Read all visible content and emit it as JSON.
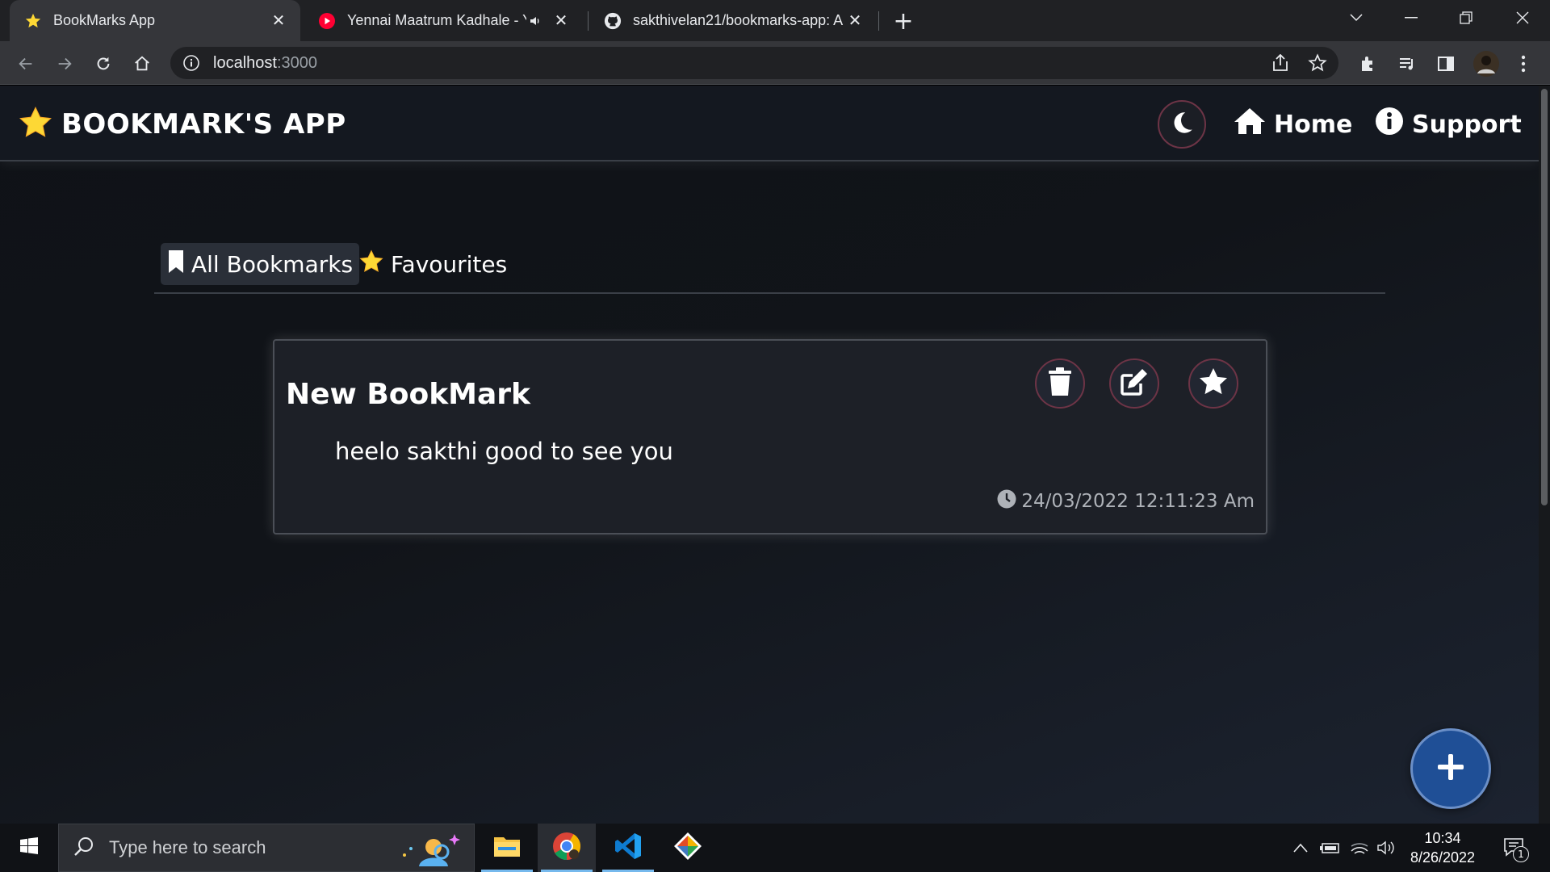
{
  "browser": {
    "tabs": [
      {
        "title": "BookMarks App",
        "favicon": "star-icon",
        "active": true
      },
      {
        "title": "Yennai Maatrum Kadhale - Yo",
        "favicon": "youtube-icon",
        "audio": true
      },
      {
        "title": "sakthivelan21/bookmarks-app: A",
        "favicon": "github-icon"
      }
    ],
    "url_host": "localhost",
    "url_port": ":3000"
  },
  "app": {
    "brand": "BOOKMARK'S APP",
    "nav": {
      "home": "Home",
      "support": "Support"
    },
    "tabs": {
      "all": "All Bookmarks",
      "favourites": "Favourites"
    },
    "bookmarks": [
      {
        "title": "New BookMark",
        "description": "heelo sakthi good to see you",
        "timestamp": "24/03/2022 12:11:23 Am"
      }
    ],
    "colors": {
      "accent_border": "#6d3446",
      "fab": "#1f4f96",
      "star": "#fdd835"
    }
  },
  "taskbar": {
    "search_placeholder": "Type here to search",
    "time": "10:34",
    "date": "8/26/2022",
    "notification_count": "1"
  }
}
